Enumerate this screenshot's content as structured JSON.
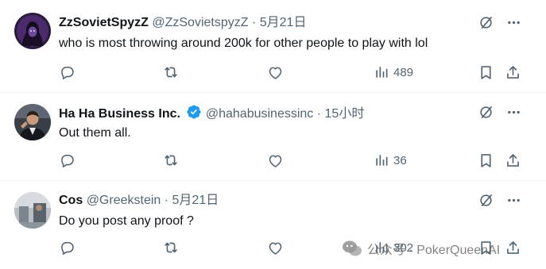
{
  "tweets": [
    {
      "name": "ZzSovietSpyzZ",
      "handle": "@ZzSovietspyzZ",
      "date": "· 5月21日",
      "text": "who is most throwing around 200k for other people to play with lol",
      "views": "489",
      "verified": false
    },
    {
      "name": "Ha Ha Business Inc.",
      "handle": "@hahabusinessinc",
      "date": "· 15小时",
      "text": "Out them all.",
      "views": "36",
      "verified": true
    },
    {
      "name": "Cos",
      "handle": "@Greekstein",
      "date": "· 5月21日",
      "text": "Do you post any proof ?",
      "views": "302",
      "verified": false
    }
  ],
  "watermark": "公众号 · PokerQueenAI",
  "colors": {
    "text": "#0f1419",
    "muted": "#536471",
    "verified": "#1d9bf0",
    "border": "#eff3f4"
  },
  "icons": [
    "grok-icon",
    "more-icon",
    "reply-icon",
    "retweet-icon",
    "like-icon",
    "views-icon",
    "bookmark-icon",
    "share-icon",
    "verified-badge-icon",
    "wechat-icon"
  ]
}
